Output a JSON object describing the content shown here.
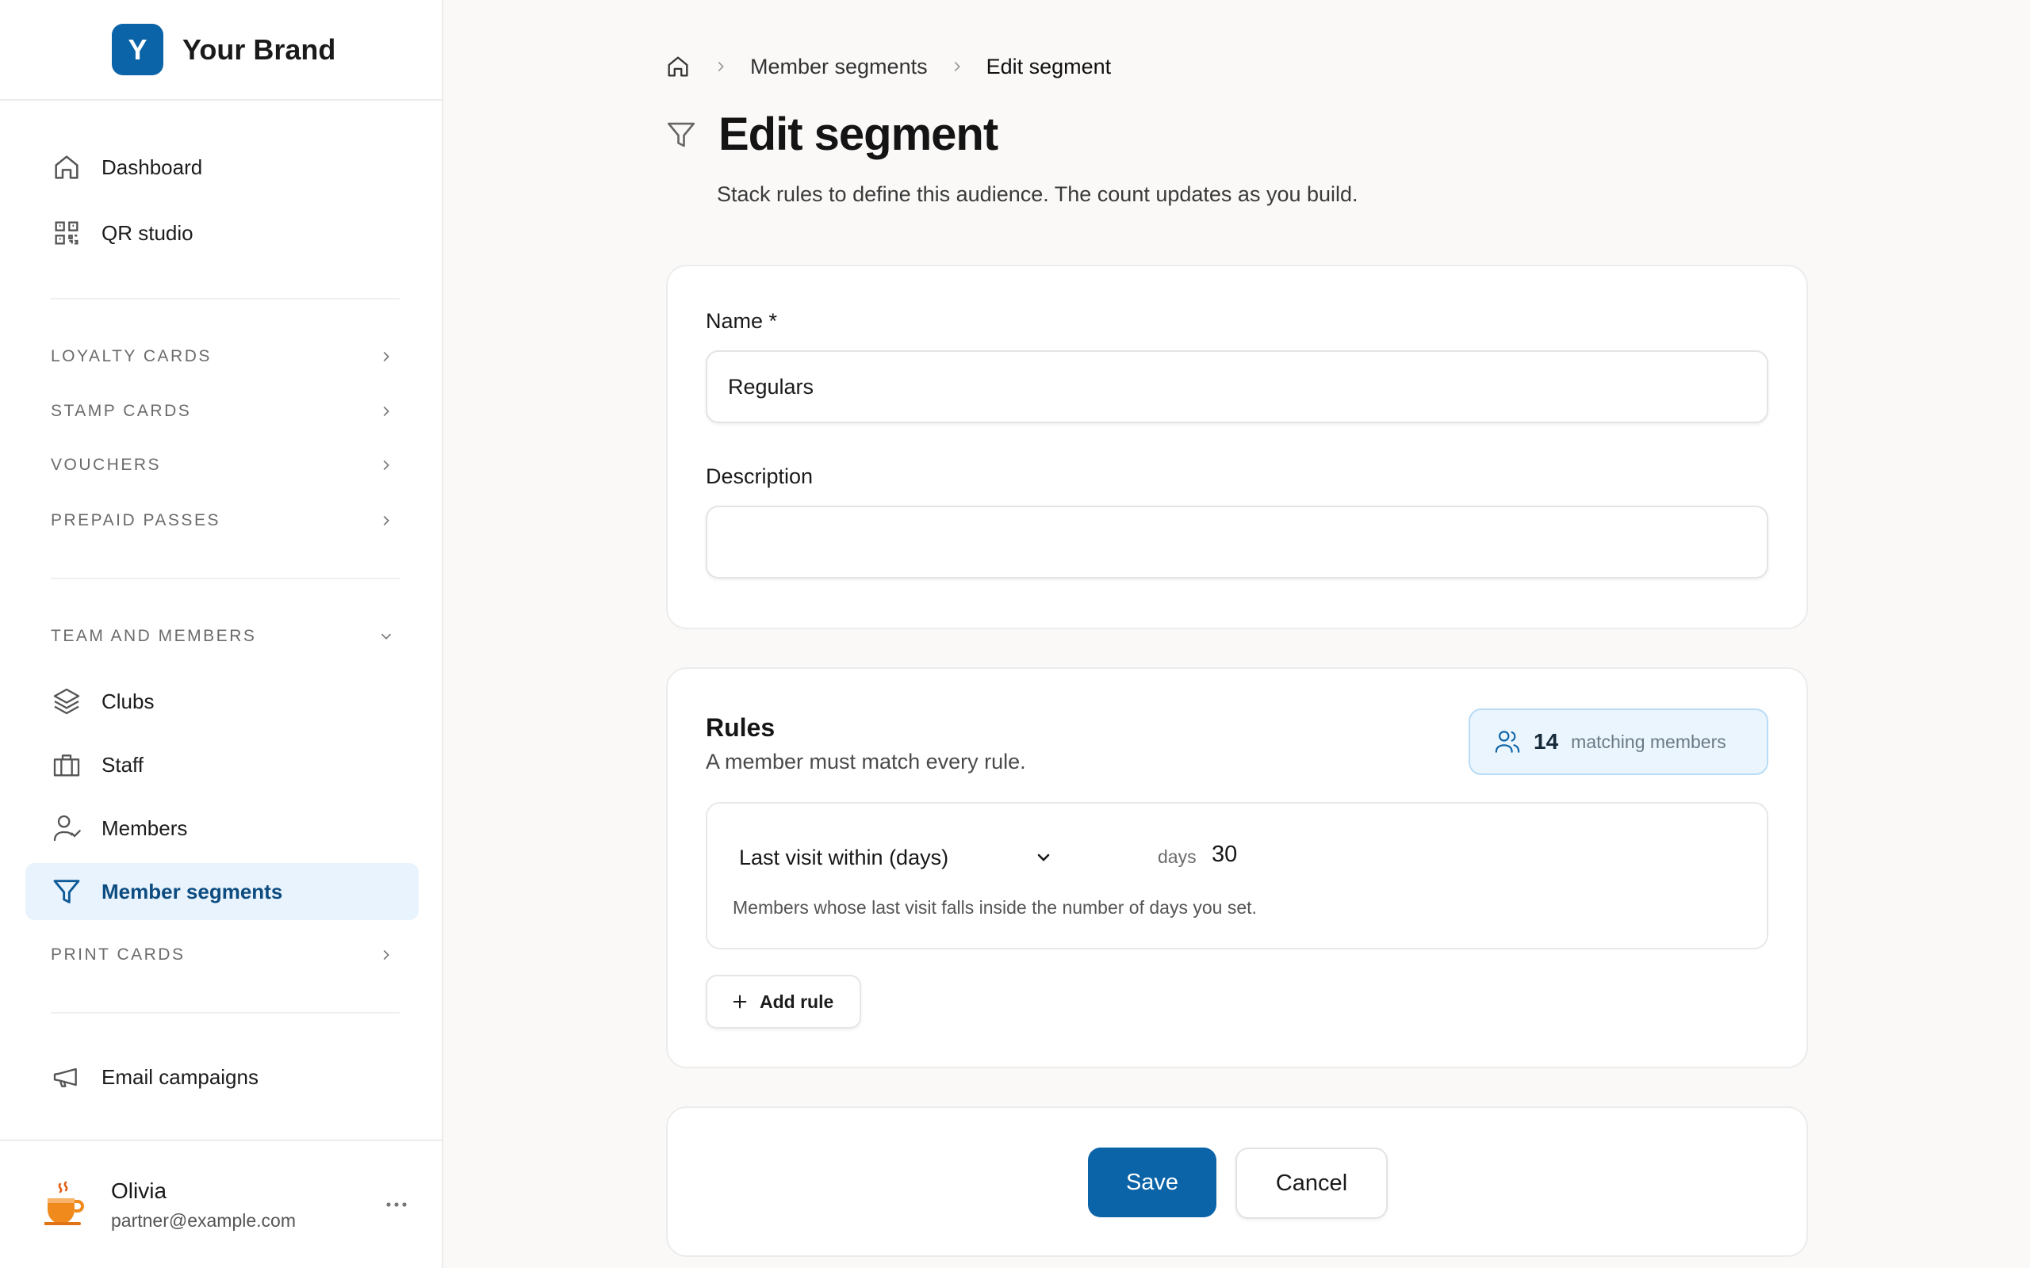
{
  "brand": {
    "initial": "Y",
    "name": "Your Brand"
  },
  "sidebar": {
    "top_items": [
      {
        "label": "Dashboard",
        "icon": "home-icon"
      },
      {
        "label": "QR studio",
        "icon": "qr-code-icon"
      }
    ],
    "sections": [
      {
        "label": "LOYALTY CARDS",
        "state": "collapsed"
      },
      {
        "label": "STAMP CARDS",
        "state": "collapsed"
      },
      {
        "label": "VOUCHERS",
        "state": "collapsed"
      },
      {
        "label": "PREPAID PASSES",
        "state": "collapsed"
      },
      {
        "label": "TEAM AND MEMBERS",
        "state": "expanded"
      },
      {
        "label": "PRINT CARDS",
        "state": "collapsed"
      }
    ],
    "team_items": [
      {
        "label": "Clubs",
        "icon": "layers-icon"
      },
      {
        "label": "Staff",
        "icon": "briefcase-icon"
      },
      {
        "label": "Members",
        "icon": "user-check-icon"
      },
      {
        "label": "Member segments",
        "icon": "filter-icon",
        "active": true
      }
    ],
    "bottom_items": [
      {
        "label": "Email campaigns",
        "icon": "megaphone-icon"
      }
    ],
    "user": {
      "name": "Olivia",
      "email": "partner@example.com",
      "avatar_icon": "coffee-cup-icon"
    }
  },
  "breadcrumb": {
    "items": [
      "Member segments",
      "Edit segment"
    ]
  },
  "page": {
    "title": "Edit segment",
    "subtitle": "Stack rules to define this audience. The count updates as you build."
  },
  "form": {
    "name_label": "Name *",
    "name_value": "Regulars",
    "description_label": "Description",
    "description_value": ""
  },
  "rules": {
    "title": "Rules",
    "subtitle": "A member must match every rule.",
    "match_count": "14",
    "match_label": "matching members",
    "items": [
      {
        "field": "Last visit within (days)",
        "unit": "days",
        "value": "30",
        "help": "Members whose last visit falls inside the number of days you set."
      }
    ],
    "add_label": "Add rule"
  },
  "actions": {
    "save_label": "Save",
    "cancel_label": "Cancel"
  },
  "colors": {
    "accent": "#0b63a8",
    "active_nav_bg": "#e8f3fd",
    "pill_bg": "#eaf5fd",
    "page_bg": "#faf9f8",
    "coffee_orange": "#f08a1c"
  }
}
